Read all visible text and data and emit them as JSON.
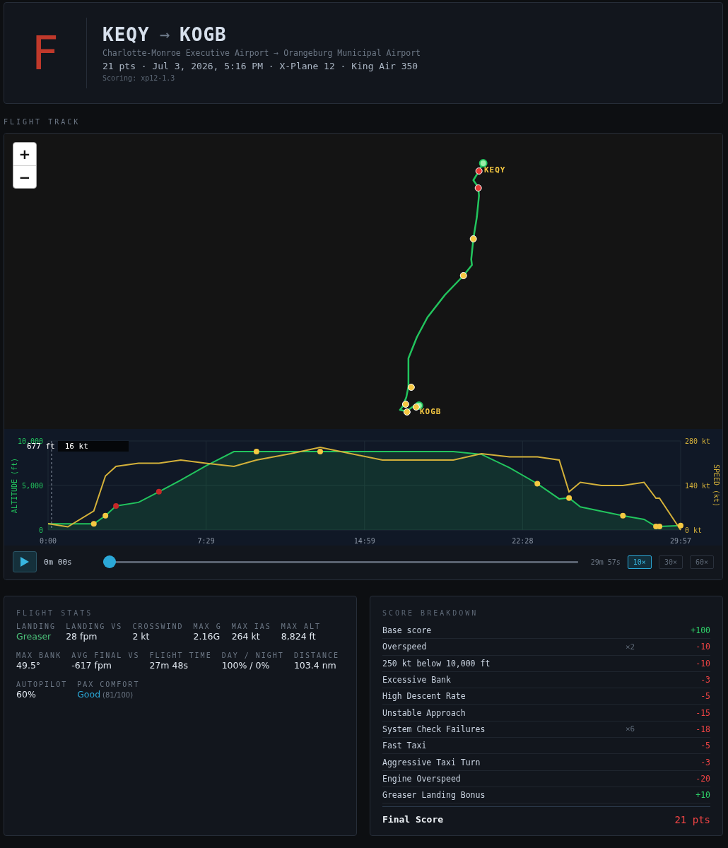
{
  "header": {
    "grade": "F",
    "origin": "KEQY",
    "arrow": "→",
    "destination": "KOGB",
    "airports": "Charlotte-Monroe Executive Airport → Orangeburg Municipal Airport",
    "details": "21 pts · Jul 3, 2026, 5:16 PM · X-Plane 12 · King Air 350",
    "scoring": "Scoring: xp12-1.3"
  },
  "track_title": "FLIGHT TRACK",
  "map": {
    "zoom_controls": [
      "+",
      "−"
    ],
    "airports": [
      {
        "code": "KEQY",
        "kind": "origin"
      },
      {
        "code": "KOGB",
        "kind": "destination"
      }
    ]
  },
  "profile": {
    "readout": {
      "altitude": "677 ft",
      "speed": "16 kt"
    },
    "chart_data": {
      "type": "line",
      "grid": true,
      "ref_lines": [
        {
          "axis": "x",
          "value": 10
        }
      ],
      "ylabel": "ALTITUDE (ft)",
      "y2label": "SPEED (kt)",
      "x": [
        0,
        56,
        130,
        163,
        193,
        257,
        315,
        377,
        448,
        528,
        592,
        689,
        773,
        950,
        1151,
        1231,
        1311,
        1390,
        1452,
        1480,
        1512,
        1572,
        1633,
        1693,
        1727,
        1737,
        1797
      ],
      "xlim": [
        0,
        1797
      ],
      "ylim": [
        0,
        10000
      ],
      "y2lim": [
        0,
        280
      ],
      "xticks": [
        {
          "value": 0,
          "label": "0:00"
        },
        {
          "value": 449,
          "label": "7:29"
        },
        {
          "value": 899,
          "label": "14:59"
        },
        {
          "value": 1348,
          "label": "22:28"
        },
        {
          "value": 1797,
          "label": "29:57"
        }
      ],
      "yticks": [
        {
          "value": 0,
          "label": "0"
        },
        {
          "value": 5000,
          "label": "5,000"
        },
        {
          "value": 10000,
          "label": "10,000"
        }
      ],
      "y2ticks": [
        {
          "value": 0,
          "label": "0 kt"
        },
        {
          "value": 140,
          "label": "140 kt"
        },
        {
          "value": 280,
          "label": "280 kt"
        }
      ],
      "series": [
        {
          "color": "#22c55e",
          "type": "area",
          "values": [
            700,
            700,
            700,
            1600,
            2700,
            3100,
            4300,
            5600,
            7200,
            8800,
            8800,
            8800,
            8800,
            8800,
            8800,
            8500,
            7000,
            5200,
            3500,
            3600,
            2600,
            2100,
            1600,
            1200,
            400,
            400,
            500
          ]
        },
        {
          "color": "#d4b13a",
          "axis": "y2",
          "values": [
            20,
            10,
            60,
            170,
            200,
            210,
            210,
            220,
            210,
            200,
            220,
            240,
            260,
            220,
            220,
            240,
            230,
            230,
            220,
            120,
            150,
            140,
            140,
            150,
            100,
            100,
            0
          ]
        },
        {
          "color": "#f5c842",
          "type": "scatter",
          "values": [
            null,
            null,
            700,
            1600,
            null,
            null,
            null,
            null,
            null,
            null,
            8800,
            null,
            8800,
            null,
            null,
            null,
            null,
            5200,
            null,
            3600,
            null,
            null,
            1600,
            null,
            400,
            400,
            500
          ]
        },
        {
          "color": "#c62828",
          "type": "scatter",
          "values": [
            null,
            null,
            null,
            null,
            2700,
            null,
            4300,
            null,
            null,
            null,
            null,
            null,
            null,
            null,
            null,
            null,
            null,
            null,
            null,
            null,
            null,
            null,
            null,
            null,
            null,
            null,
            null
          ]
        }
      ]
    }
  },
  "playback": {
    "elapsed": "0m 00s",
    "level": 0,
    "total": "29m 57s",
    "speeds": [
      {
        "label": "10×",
        "selected": true
      },
      {
        "label": "30×",
        "selected": false
      },
      {
        "label": "60×",
        "selected": false
      }
    ]
  },
  "stats": {
    "title": "FLIGHT STATS",
    "groups": [
      {
        "items": [
          {
            "label": "LANDING",
            "value": "Greaser",
            "color": "#4cc27a"
          },
          {
            "label": "LANDING VS",
            "value": "28 fpm"
          },
          {
            "label": "CROSSWIND",
            "value": "2 kt"
          },
          {
            "label": "MAX G",
            "value": "2.16G"
          },
          {
            "label": "MAX IAS",
            "value": "264 kt"
          },
          {
            "label": "MAX ALT",
            "value": "8,824 ft"
          }
        ]
      },
      {
        "items": [
          {
            "label": "MAX BANK",
            "value": "49.5°"
          },
          {
            "label": "AVG FINAL VS",
            "value": "-617 fpm"
          },
          {
            "label": "FLIGHT TIME",
            "value": "27m 48s"
          },
          {
            "label": "DAY / NIGHT",
            "value": "100% / 0%"
          },
          {
            "label": "DISTANCE",
            "value": "103.4 nm"
          }
        ]
      },
      {
        "items": [
          {
            "label": "AUTOPILOT",
            "value": "60%"
          },
          {
            "label": "PAX COMFORT",
            "value": "Good",
            "color": "#2ba8d8",
            "note": "(81/100)"
          }
        ]
      }
    ]
  },
  "score": {
    "title": "SCORE BREAKDOWN",
    "items": [
      {
        "label": "Base score",
        "points": "+100",
        "color": "#2fd46a"
      },
      {
        "label": "Overspeed",
        "count": "×2",
        "points": "-10",
        "color": "#ef4444"
      },
      {
        "label": "250 kt below 10,000 ft",
        "points": "-10",
        "color": "#ef4444"
      },
      {
        "label": "Excessive Bank",
        "points": "-3",
        "color": "#ef4444"
      },
      {
        "label": "High Descent Rate",
        "points": "-5",
        "color": "#ef4444"
      },
      {
        "label": "Unstable Approach",
        "points": "-15",
        "color": "#ef4444"
      },
      {
        "label": "System Check Failures",
        "count": "×6",
        "points": "-18",
        "color": "#ef4444"
      },
      {
        "label": "Fast Taxi",
        "points": "-5",
        "color": "#ef4444"
      },
      {
        "label": "Aggressive Taxi Turn",
        "points": "-3",
        "color": "#ef4444"
      },
      {
        "label": "Engine Overspeed",
        "points": "-20",
        "color": "#ef4444"
      },
      {
        "label": "Greaser Landing Bonus",
        "points": "+10",
        "color": "#2fd46a"
      }
    ],
    "final": {
      "label": "Final Score",
      "value": "21 pts"
    }
  }
}
